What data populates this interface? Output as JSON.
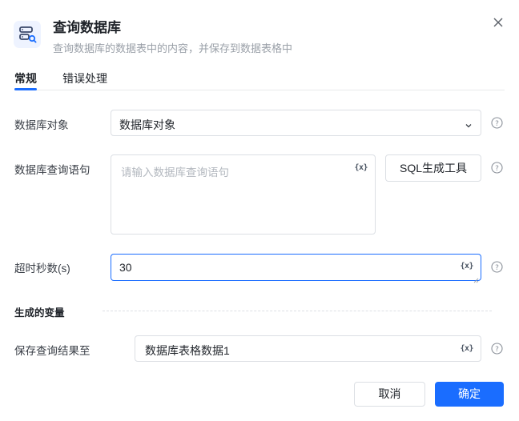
{
  "dialog": {
    "title": "查询数据库",
    "subtitle": "查询数据库的数据表中的内容，并保存到数据表格中",
    "header_icon": "database-query-icon",
    "accent_color": "#1a6dff"
  },
  "tabs": [
    {
      "label": "常规",
      "active": true
    },
    {
      "label": "错误处理",
      "active": false
    }
  ],
  "form": {
    "db_object": {
      "label": "数据库对象",
      "value": "数据库对象"
    },
    "query": {
      "label": "数据库查询语句",
      "placeholder": "请输入数据库查询语句",
      "var_tag": "{x}",
      "tool_button": "SQL生成工具"
    },
    "timeout": {
      "label": "超时秒数(s)",
      "value": "30",
      "var_tag": "{x}"
    }
  },
  "output_section": {
    "title": "生成的变量",
    "save_to": {
      "label": "保存查询结果至",
      "value": "数据库表格数据1",
      "var_tag": "{x}"
    }
  },
  "footer": {
    "cancel": "取消",
    "confirm": "确定"
  }
}
